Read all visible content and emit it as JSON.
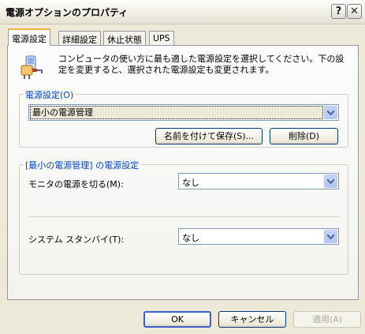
{
  "window": {
    "title": "電源オプションのプロパティ",
    "help_symbol": "?",
    "close_symbol": "✕"
  },
  "tabs": [
    {
      "label": "電源設定",
      "active": true
    },
    {
      "label": "詳細設定",
      "active": false
    },
    {
      "label": "休止状態",
      "active": false
    },
    {
      "label": "UPS",
      "active": false
    }
  ],
  "description": "コンピュータの使い方に最も適した電源設定を選択してください。下の設定を変更すると、選択された電源設定も変更されます。",
  "power_scheme": {
    "group_label": "電源設定(O)",
    "selected": "最小の電源管理",
    "save_as_label": "名前を付けて保存(S)...",
    "delete_label": "削除(D)"
  },
  "scheme_settings": {
    "group_label": "[最小の電源管理] の電源設定",
    "monitor_label": "モニタの電源を切る(M):",
    "monitor_value": "なし",
    "standby_label": "システム スタンバイ(T):",
    "standby_value": "なし"
  },
  "footer": {
    "ok_label": "OK",
    "cancel_label": "キャンセル",
    "apply_label": "適用(A)"
  },
  "colors": {
    "face": "#ece9d8",
    "group_label": "#0046d5",
    "tab_accent": "#f1b23b"
  }
}
